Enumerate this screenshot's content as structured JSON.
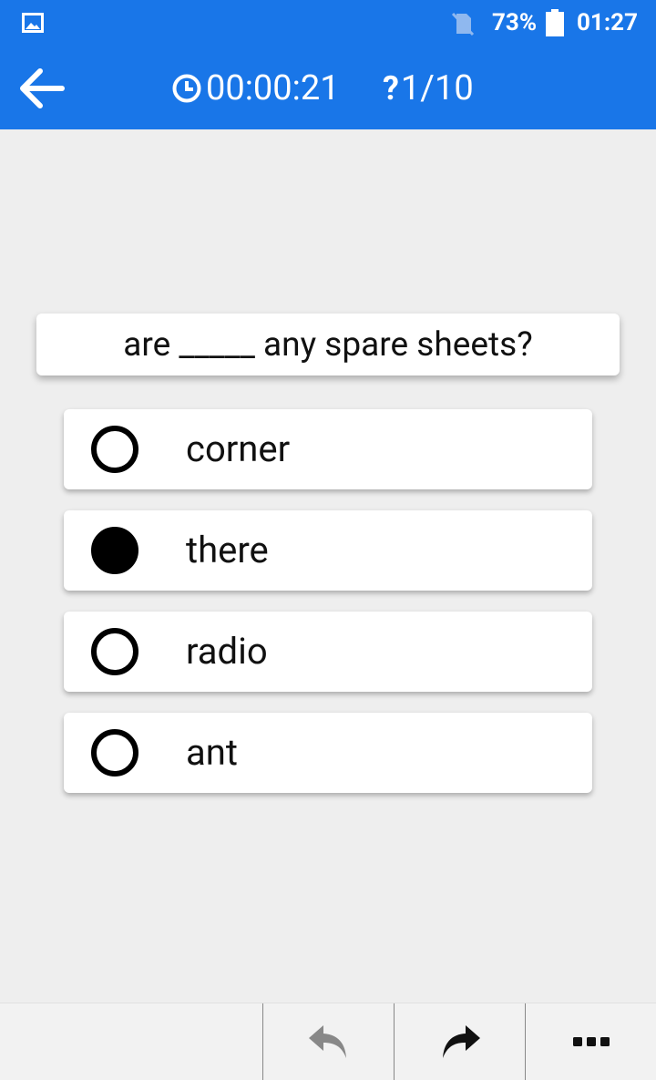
{
  "status_bar": {
    "battery_percent": "73%",
    "time": "01:27",
    "icons": [
      "image-icon",
      "no-sim-icon",
      "battery-icon"
    ]
  },
  "header": {
    "back_icon": "arrow-left-icon",
    "timer_icon": "clock-icon",
    "timer": "00:00:21",
    "question_icon": "question-mark-icon",
    "progress": "1/10"
  },
  "question": {
    "text": "are _____ any spare sheets?"
  },
  "options": [
    {
      "label": "corner",
      "selected": false
    },
    {
      "label": "there",
      "selected": true
    },
    {
      "label": "radio",
      "selected": false
    },
    {
      "label": "ant",
      "selected": false
    }
  ],
  "bottom_bar": {
    "undo_icon": "undo-icon",
    "redo_icon": "redo-icon",
    "more_icon": "more-horizontal-icon"
  },
  "colors": {
    "primary": "#1976e8",
    "background": "#eeeeee",
    "card": "#ffffff"
  }
}
